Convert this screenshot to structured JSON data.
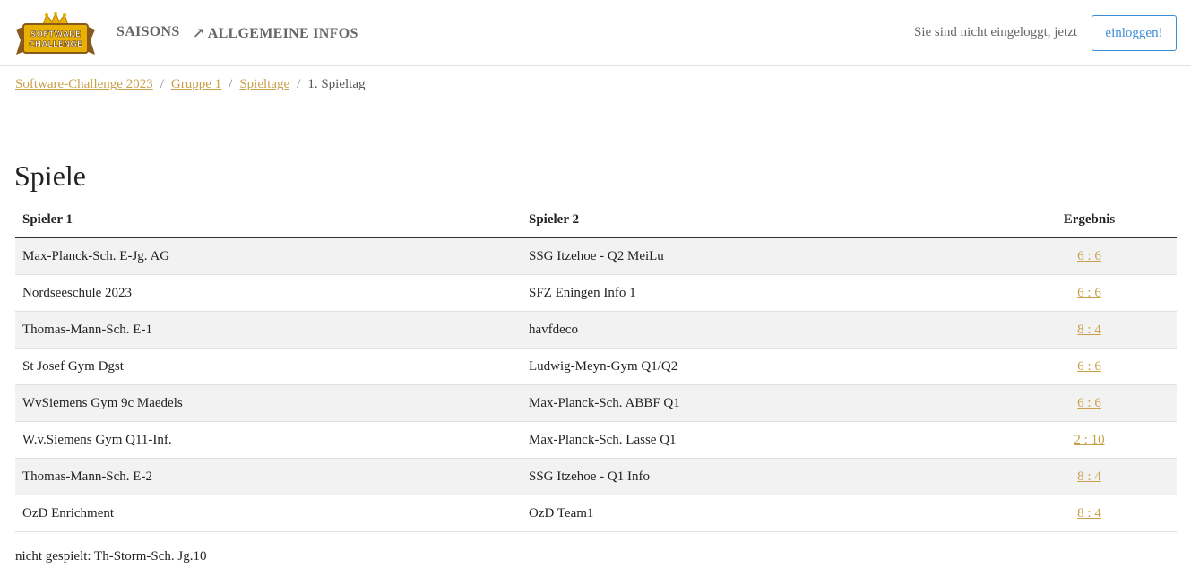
{
  "nav": {
    "logo_text_top": "SOFTWARE",
    "logo_text_bottom": "CHALLENGE",
    "saisons": "SAISONS",
    "infos": "ALLGEMEINE INFOS",
    "infos_icon": "external-link-icon",
    "login_text": "Sie sind nicht eingeloggt, jetzt",
    "login_button": "einloggen!"
  },
  "colors": {
    "accent": "#c9a04a",
    "login": "#3b8ed6",
    "logo_gold": "#e8b100",
    "logo_brown": "#8a5a1c"
  },
  "breadcrumb": {
    "items": [
      "Software-Challenge 2023",
      "Gruppe 1",
      "Spieltage"
    ],
    "current": "1. Spieltag",
    "separator": "/"
  },
  "title": "Spiele",
  "table": {
    "headers": [
      "Spieler 1",
      "Spieler 2",
      "Ergebnis"
    ],
    "rows": [
      {
        "p1": "Max-Planck-Sch. E-Jg. AG",
        "p2": "SSG Itzehoe - Q2 MeiLu",
        "result": "6 : 6"
      },
      {
        "p1": "Nordseeschule 2023",
        "p2": "SFZ Eningen Info 1",
        "result": "6 : 6"
      },
      {
        "p1": "Thomas-Mann-Sch. E-1",
        "p2": "havfdeco",
        "result": "8 : 4"
      },
      {
        "p1": "St Josef Gym Dgst",
        "p2": "Ludwig-Meyn-Gym Q1/Q2",
        "result": "6 : 6"
      },
      {
        "p1": "WvSiemens Gym 9c Maedels",
        "p2": "Max-Planck-Sch. ABBF Q1",
        "result": "6 : 6"
      },
      {
        "p1": "W.v.Siemens Gym Q11-Inf.",
        "p2": "Max-Planck-Sch. Lasse Q1",
        "result": "2 : 10"
      },
      {
        "p1": "Thomas-Mann-Sch. E-2",
        "p2": "SSG Itzehoe - Q1 Info",
        "result": "8 : 4"
      },
      {
        "p1": "OzD Enrichment",
        "p2": "OzD Team1",
        "result": "8 : 4"
      }
    ]
  },
  "note": "nicht gespielt: Th-Storm-Sch. Jg.10"
}
